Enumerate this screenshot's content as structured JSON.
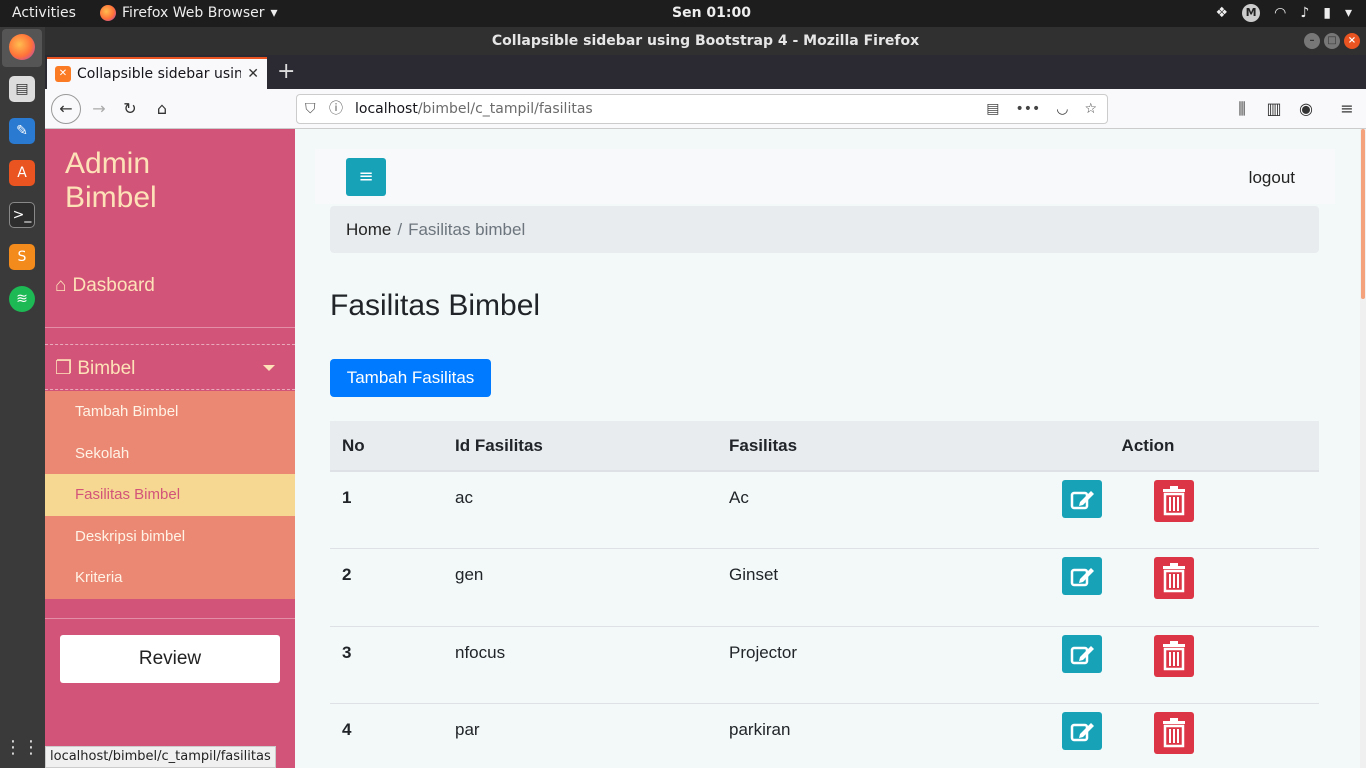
{
  "os": {
    "activities": "Activities",
    "app_name": "Firefox Web Browser",
    "clock": "Sen 01:00"
  },
  "browser": {
    "window_title": "Collapsible sidebar using Bootstrap 4 - Mozilla Firefox",
    "tab_title": "Collapsible sidebar using Bootstrap 4",
    "url_host": "localhost",
    "url_path": "/bimbel/c_tampil/fasilitas",
    "status_url": "localhost/bimbel/c_tampil/fasilitas"
  },
  "sidebar": {
    "brand_line1": "Admin",
    "brand_line2": "Bimbel",
    "dashboard": "Dasboard",
    "bimbel": "Bimbel",
    "submenu": [
      "Tambah Bimbel",
      "Sekolah",
      "Fasilitas Bimbel",
      "Deskripsi bimbel",
      "Kriteria"
    ],
    "review": "Review"
  },
  "main": {
    "logout": "logout",
    "breadcrumb_home": "Home",
    "breadcrumb_sep": "/",
    "breadcrumb_current": "Fasilitas bimbel",
    "title": "Fasilitas Bimbel",
    "add_button": "Tambah Fasilitas"
  },
  "table": {
    "headers": [
      "No",
      "Id Fasilitas",
      "Fasilitas",
      "Action"
    ],
    "rows": [
      {
        "no": "1",
        "id": "ac",
        "name": "Ac"
      },
      {
        "no": "2",
        "id": "gen",
        "name": "Ginset"
      },
      {
        "no": "3",
        "id": "nfocus",
        "name": "Projector"
      },
      {
        "no": "4",
        "id": "par",
        "name": "parkiran"
      }
    ]
  },
  "colors": {
    "sidebar_bg": "#d35479",
    "submenu_bg": "#ea8874",
    "submenu_active_bg": "#f7d893",
    "edit_button": "#17a2b8",
    "delete_button": "#dc3545",
    "primary_button": "#007bff"
  }
}
